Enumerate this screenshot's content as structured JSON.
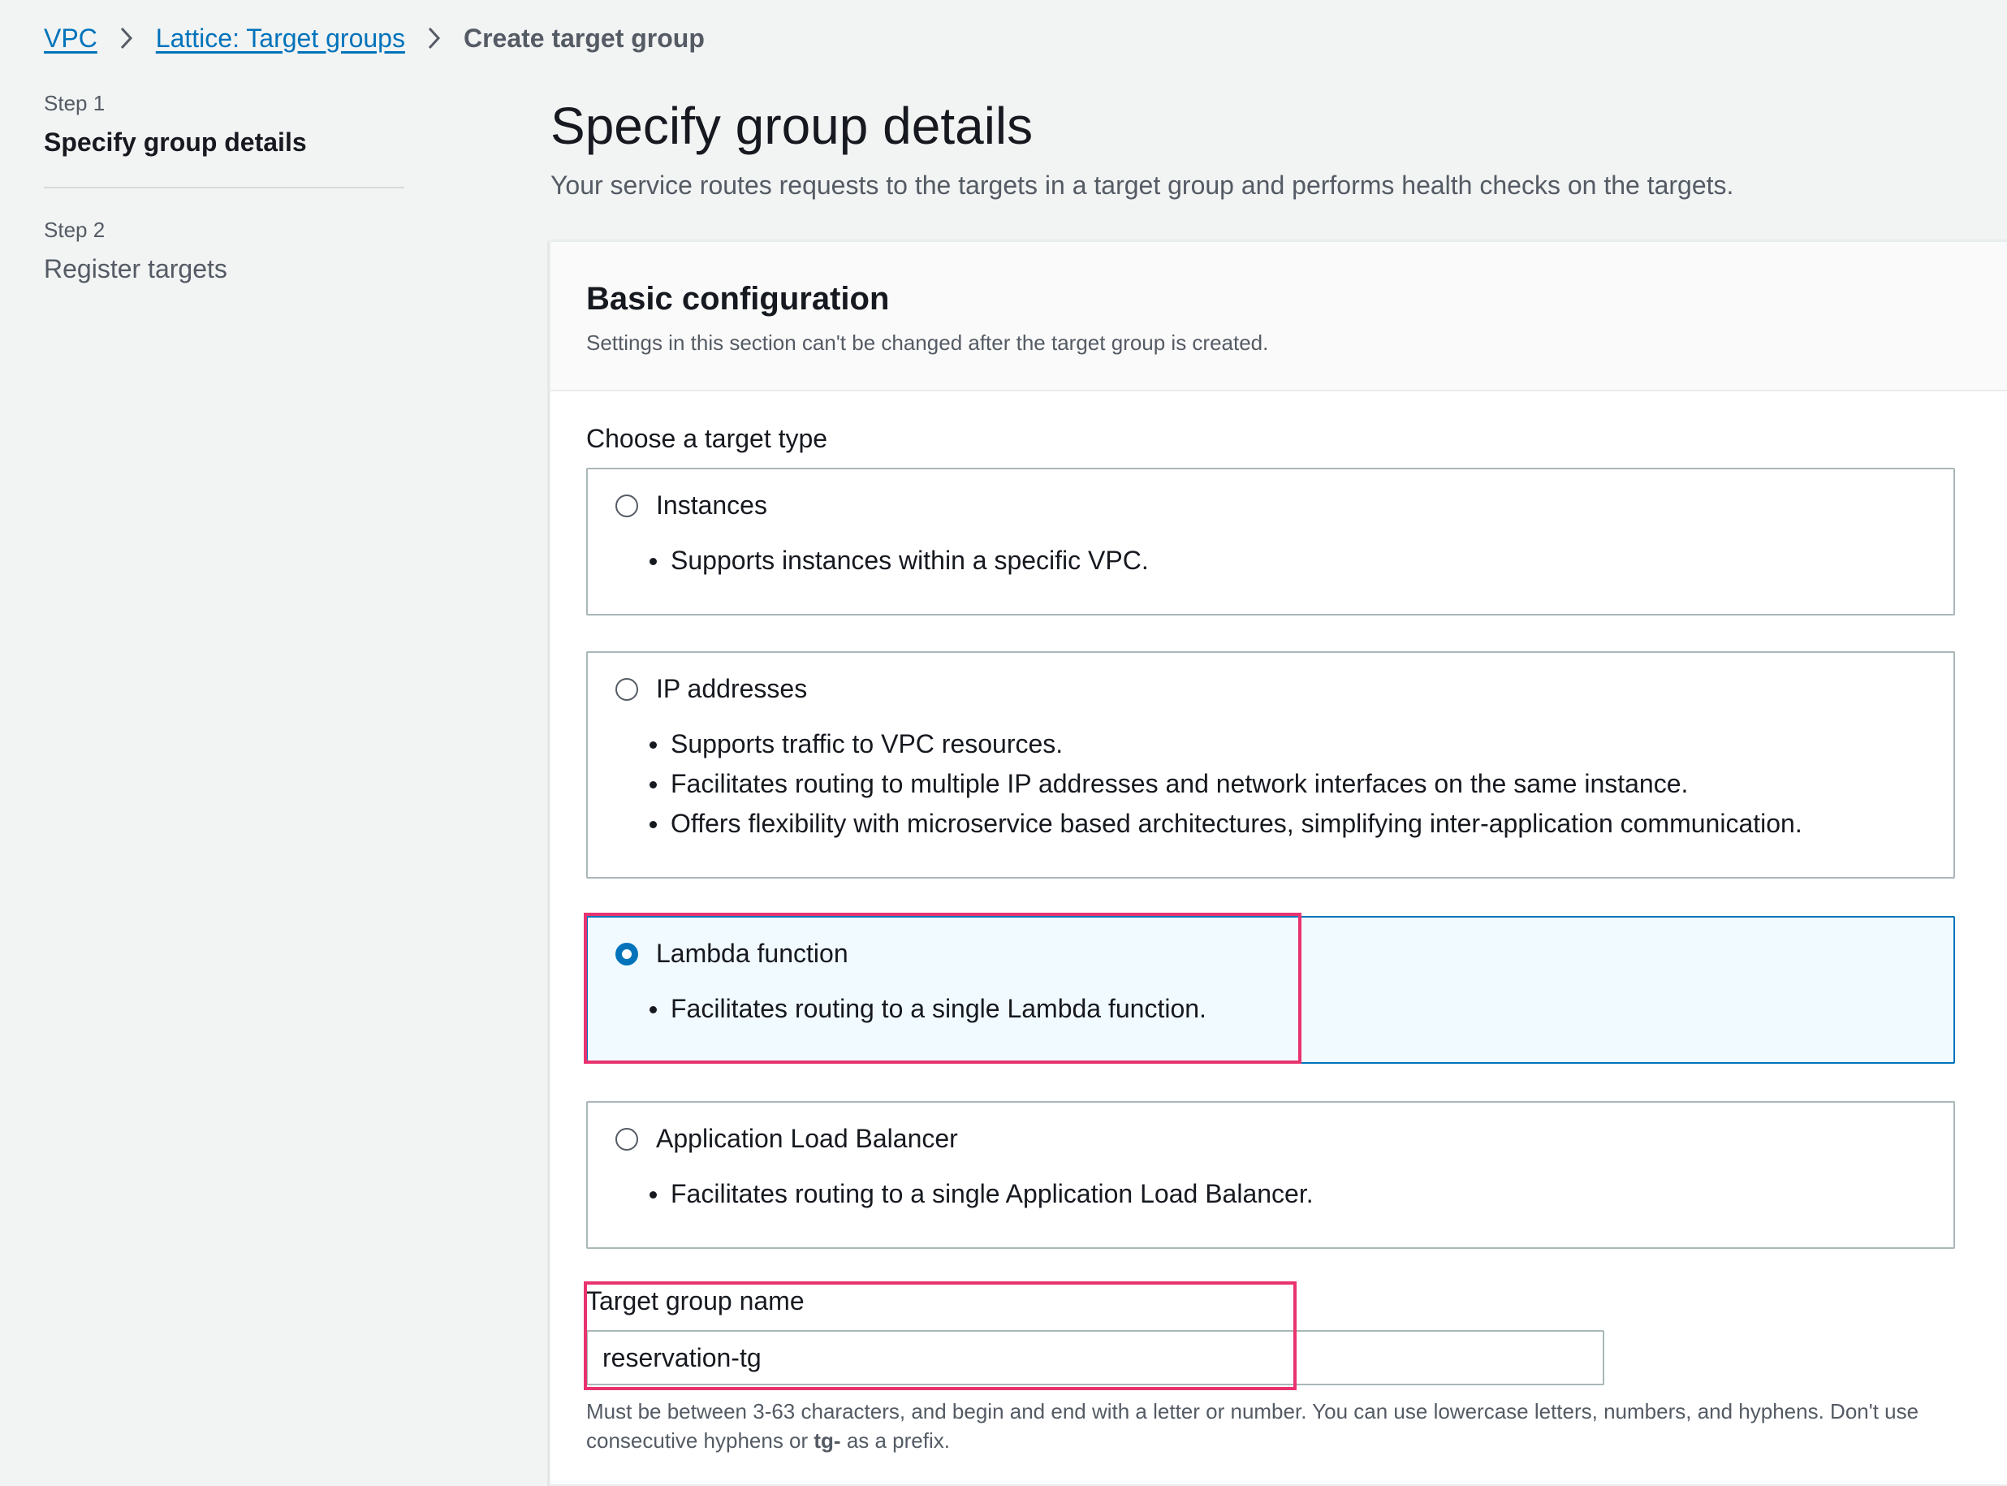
{
  "breadcrumb": {
    "items": [
      {
        "label": "VPC"
      },
      {
        "label": "Lattice: Target groups"
      },
      {
        "label": "Create target group"
      }
    ]
  },
  "steps": [
    {
      "number": "Step 1",
      "title": "Specify group details",
      "active": true
    },
    {
      "number": "Step 2",
      "title": "Register targets",
      "active": false
    }
  ],
  "page": {
    "title": "Specify group details",
    "description": "Your service routes requests to the targets in a target group and performs health checks on the targets."
  },
  "panel": {
    "title": "Basic configuration",
    "subtitle": "Settings in this section can't be changed after the target group is created."
  },
  "target_type": {
    "label": "Choose a target type",
    "selected": "Lambda function",
    "options": [
      {
        "label": "Instances",
        "bullets": [
          "Supports instances within a specific VPC."
        ]
      },
      {
        "label": "IP addresses",
        "bullets": [
          "Supports traffic to VPC resources.",
          "Facilitates routing to multiple IP addresses and network interfaces on the same instance.",
          "Offers flexibility with microservice based architectures, simplifying inter-application communication."
        ]
      },
      {
        "label": "Lambda function",
        "bullets": [
          "Facilitates routing to a single Lambda function."
        ]
      },
      {
        "label": "Application Load Balancer",
        "bullets": [
          "Facilitates routing to a single Application Load Balancer."
        ]
      }
    ]
  },
  "target_group_name": {
    "label": "Target group name",
    "value": "reservation-tg",
    "hint_part1": "Must be between 3-63 characters, and begin and end with a letter or number. You can use lowercase letters, numbers, and hyphens. Don't use consecutive hyphens or ",
    "hint_bold": "tg-",
    "hint_part2": " as a prefix."
  },
  "colors": {
    "link": "#0073bb",
    "selected_border": "#0073bb",
    "selected_bg": "#f1faff",
    "annotation_highlight": "#e8336e"
  }
}
